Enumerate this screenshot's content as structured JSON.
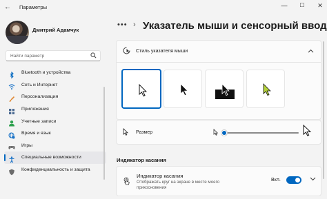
{
  "window": {
    "title": "Параметры",
    "back_glyph": "←",
    "controls": {
      "minimize": "—",
      "maximize": "☐",
      "close": "✕"
    }
  },
  "user": {
    "name": "Дмитрий Адамчук"
  },
  "search": {
    "placeholder": "Найти параметр",
    "icon": "search-icon"
  },
  "nav": {
    "items": [
      {
        "label": "Bluetooth и устройства",
        "icon": "bluetooth-icon",
        "color": "#0067c0"
      },
      {
        "label": "Сеть и Интернет",
        "icon": "wifi-icon",
        "color": "#1a73c7"
      },
      {
        "label": "Персонализация",
        "icon": "brush-icon",
        "color": "#e08a36"
      },
      {
        "label": "Приложения",
        "icon": "apps-icon",
        "color": "#4c6a92"
      },
      {
        "label": "Учетные записи",
        "icon": "person-icon",
        "color": "#2fa14f"
      },
      {
        "label": "Время и язык",
        "icon": "globe-clock-icon",
        "color": "#1a73c7"
      },
      {
        "label": "Игры",
        "icon": "gamepad-icon",
        "color": "#6b6b6b"
      },
      {
        "label": "Специальные возможности",
        "icon": "accessibility-icon",
        "color": "#1a73c7"
      },
      {
        "label": "Конфиденциальность и защита",
        "icon": "shield-icon",
        "color": "#6b6b6b"
      }
    ],
    "active_index": 7
  },
  "header": {
    "breadcrumb_dots": "•••",
    "breadcrumb_chevron": "›",
    "title": "Указатель мыши и сенсорный ввод"
  },
  "pointer_style": {
    "label": "Стиль указателя мыши",
    "icon": "mouse-pointer-style-icon",
    "expanded": true,
    "options": [
      {
        "name": "white",
        "selected": true
      },
      {
        "name": "black",
        "selected": false
      },
      {
        "name": "inverted",
        "selected": false
      },
      {
        "name": "custom",
        "selected": false,
        "color": "#b5d33a"
      }
    ]
  },
  "size": {
    "label": "Размер",
    "icon": "pointer-icon",
    "value_fraction": 0.0
  },
  "touch_section": {
    "title": "Индикатор касания",
    "setting_title": "Индикатор касания",
    "description": "Отображать круг на экране в месте моего прикосновения",
    "toggle_label": "Вкл.",
    "toggle_on": true,
    "icon": "touch-indicator-icon"
  },
  "colors": {
    "accent": "#0067c0"
  }
}
